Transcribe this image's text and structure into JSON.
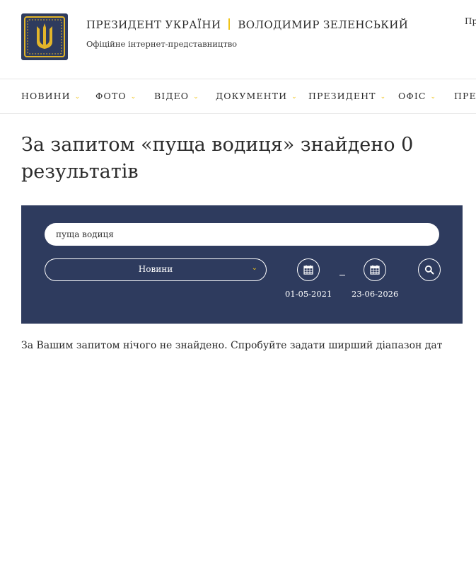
{
  "header": {
    "title_left": "ПРЕЗИДЕНТ УКРАЇНИ",
    "title_right": "ВОЛОДИМИР ЗЕЛЕНСЬКИЙ",
    "subtitle": "Офіційне інтернет-представництво",
    "logo_icon": "trident-coat-of-arms-icon",
    "lang_link": "Пр"
  },
  "nav": {
    "items": [
      {
        "label": "НОВИНИ"
      },
      {
        "label": "ФОТО"
      },
      {
        "label": "ВІДЕО"
      },
      {
        "label": "ДОКУМЕНТИ"
      },
      {
        "label": "ПРЕЗИДЕНТ"
      },
      {
        "label": "ОФІС"
      },
      {
        "label": "ПРЕС"
      }
    ],
    "chevron_icon": "chevron-down-icon"
  },
  "page": {
    "title": "За запитом «пуща водиця» знайдено 0 результатів",
    "message": "За Вашим запитом нічого не знайдено. Спробуйте задати ширший діапазон дат"
  },
  "search": {
    "query": "пуща водиця",
    "category": "Новини",
    "date_from": "01-05-2021",
    "date_to": "23-06-2026",
    "calendar_icon": "calendar-icon",
    "search_icon": "search-icon"
  },
  "colors": {
    "panel_bg": "#2e3b5e",
    "accent": "#f0c419",
    "text": "#2b2b2b"
  }
}
